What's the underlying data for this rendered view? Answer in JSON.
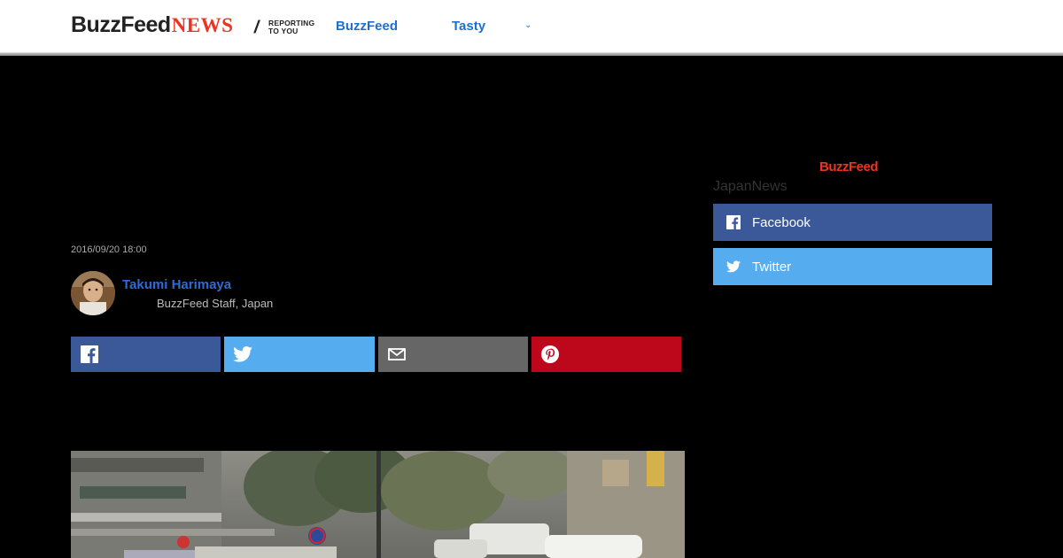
{
  "header": {
    "logo_main": "BuzzFeed",
    "logo_news": "NEWS",
    "slash": "/",
    "tagline_line1": "REPORTING",
    "tagline_line2": "TO YOU",
    "nav": [
      {
        "label": "BuzzFeed"
      },
      {
        "label": "Tasty"
      }
    ],
    "more_chevron": "⌄"
  },
  "article": {
    "timestamp": "2016/09/20 18:00",
    "author": {
      "name": "Takumi Harimaya",
      "title": "BuzzFeed Staff, Japan"
    },
    "share_buttons": [
      "facebook-icon",
      "twitter-icon",
      "mail-icon",
      "pinterest-icon"
    ]
  },
  "sidebar": {
    "logo": "BuzzFeed",
    "heading": "JapanNews",
    "buttons": [
      {
        "label": "Facebook",
        "icon": "facebook-icon"
      },
      {
        "label": "Twitter",
        "icon": "twitter-icon"
      }
    ]
  },
  "colors": {
    "facebook": "#3b5998",
    "twitter": "#55acee",
    "mail": "#666666",
    "pinterest": "#bd081c",
    "link_blue": "#1e6fcf",
    "brand_red": "#ee3322"
  }
}
